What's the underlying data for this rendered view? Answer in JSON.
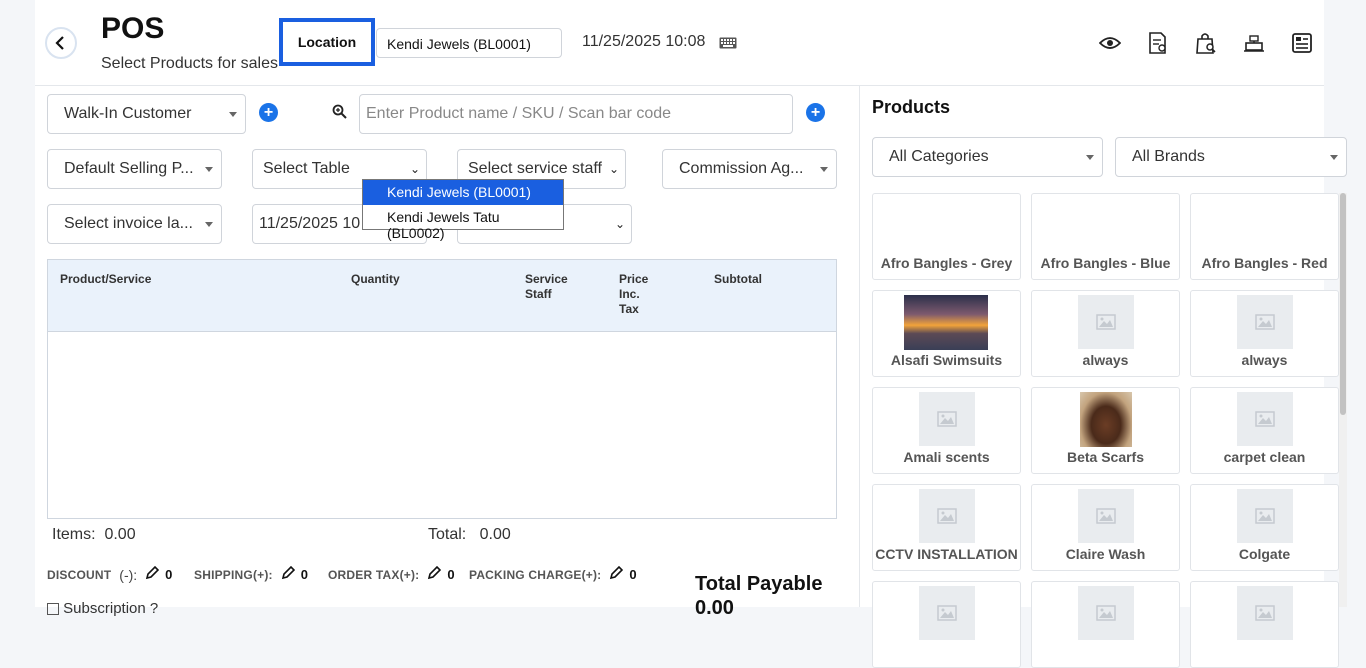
{
  "header": {
    "title": "POS",
    "subtitle": "Select Products for sales",
    "location_label": "Location",
    "location_value": "Kendi Jewels (BL0001)",
    "datetime": "11/25/2025 10:08"
  },
  "location_dropdown": {
    "options": [
      "Kendi Jewels (BL0001)",
      "Kendi Jewels Tatu (BL0002)"
    ],
    "selected_index": 0
  },
  "form": {
    "customer": "Walk-In Customer",
    "search_placeholder": "Enter Product name / SKU / Scan bar code",
    "price_group": "Default Selling P...",
    "table": "Select Table",
    "service_staff": "Select service staff",
    "commission_agent": "Commission Ag...",
    "invoice_layout": "Select invoice la...",
    "date": "11/25/2025 10"
  },
  "table": {
    "headers": [
      "Product/Service",
      "Quantity",
      "Service Staff",
      "Price Inc. Tax",
      "Subtotal"
    ],
    "rows": []
  },
  "totals": {
    "items_label": "Items:",
    "items_value": "0.00",
    "total_label": "Total:",
    "total_value": "0.00",
    "discount_label": "DISCOUNT",
    "discount_sign": "(-):",
    "discount_value": "0",
    "shipping_label": "SHIPPING(+):",
    "shipping_value": "0",
    "order_tax_label": "ORDER TAX(+):",
    "order_tax_value": "0",
    "packing_label": "PACKING CHARGE(+):",
    "packing_value": "0",
    "total_payable_label": "Total Payable",
    "total_payable_value": "0.00",
    "subscription_label": "Subscription ?"
  },
  "products_panel": {
    "title": "Products",
    "category_filter": "All Categories",
    "brand_filter": "All Brands",
    "items": [
      {
        "name": "Afro Bangles - Grey",
        "image": "none"
      },
      {
        "name": "Afro Bangles - Blue",
        "image": "none"
      },
      {
        "name": "Afro Bangles - Red",
        "image": "none"
      },
      {
        "name": "Alsafi Swimsuits",
        "image": "sunset-photo"
      },
      {
        "name": "always",
        "image": "placeholder"
      },
      {
        "name": "always",
        "image": "placeholder"
      },
      {
        "name": "Amali scents",
        "image": "placeholder"
      },
      {
        "name": "Beta Scarfs",
        "image": "portrait-photo"
      },
      {
        "name": "carpet clean",
        "image": "placeholder"
      },
      {
        "name": "CCTV INSTALLATION",
        "image": "placeholder"
      },
      {
        "name": "Claire Wash",
        "image": "placeholder"
      },
      {
        "name": "Colgate",
        "image": "placeholder"
      },
      {
        "name": "",
        "image": "placeholder"
      },
      {
        "name": "",
        "image": "placeholder"
      },
      {
        "name": "",
        "image": "placeholder"
      }
    ]
  },
  "colors": {
    "accent": "#1a5fe0",
    "plus": "#1a73e8",
    "table_header_bg": "#eaf2fb"
  }
}
